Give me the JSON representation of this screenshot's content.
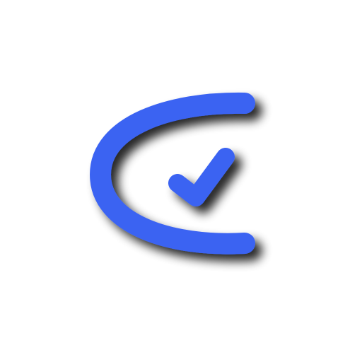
{
  "logo": {
    "name": "c-check-logo",
    "icons": [
      "c-arc-icon",
      "checkmark-icon"
    ],
    "colors": {
      "background": "#ffffff",
      "primary": "#3a63f2",
      "shadow": "#000000"
    }
  }
}
